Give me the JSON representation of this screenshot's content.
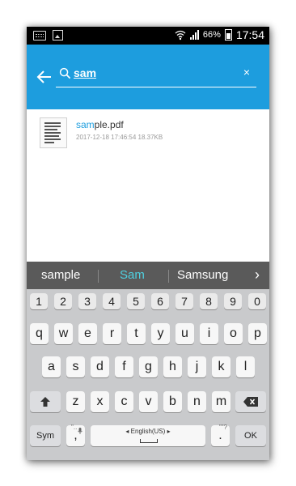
{
  "status_bar": {
    "battery": "66%",
    "time": "17:54",
    "icons": [
      "keyboard-icon",
      "image-icon",
      "wifi-icon",
      "signal-icon",
      "battery-icon"
    ]
  },
  "search": {
    "query": "sam",
    "back_icon": "arrow-left-icon",
    "search_icon": "search-icon",
    "clear_icon": "close-icon",
    "clear_label": "×"
  },
  "results": [
    {
      "name_highlight": "sam",
      "name_rest": "ple.pdf",
      "meta": "2017-12-18 17:46:54 18.37KB",
      "icon": "pdf-thumbnail-icon"
    }
  ],
  "suggestions": [
    "sample",
    "Sam",
    "Samsung"
  ],
  "suggestion_arrow": "›",
  "keyboard": {
    "numbers": [
      "1",
      "2",
      "3",
      "4",
      "5",
      "6",
      "7",
      "8",
      "9",
      "0"
    ],
    "row1": [
      "q",
      "w",
      "e",
      "r",
      "t",
      "y",
      "u",
      "i",
      "o",
      "p"
    ],
    "row2": [
      "a",
      "s",
      "d",
      "f",
      "g",
      "h",
      "j",
      "k",
      "l"
    ],
    "row3": [
      "z",
      "x",
      "c",
      "v",
      "b",
      "n",
      "m"
    ],
    "sym": "Sym",
    "comma": ",",
    "space": "English(US)",
    "period": ".",
    "ok": "OK",
    "shift_icon": "shift-arrow-icon",
    "backspace_icon": "backspace-icon"
  },
  "colors": {
    "accent": "#1d9dde",
    "suggestion_active": "#4fd0e0"
  }
}
